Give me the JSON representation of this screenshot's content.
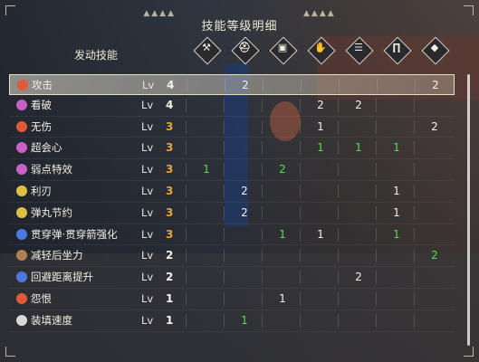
{
  "title": "技能等级明细",
  "header_label": "发动技能",
  "weapon_slots": [
    {
      "icon": "weapon-icon",
      "glyph": "⚒"
    },
    {
      "icon": "head-armor-icon",
      "glyph": "⛑"
    },
    {
      "icon": "chest-armor-icon",
      "glyph": "▣"
    },
    {
      "icon": "arm-armor-icon",
      "glyph": "✋"
    },
    {
      "icon": "waist-armor-icon",
      "glyph": "☰"
    },
    {
      "icon": "leg-armor-icon",
      "glyph": "∏"
    },
    {
      "icon": "talisman-icon",
      "glyph": "◆"
    }
  ],
  "level_prefix": "Lv",
  "skills": [
    {
      "name": "攻击",
      "icon_color": "#e05a3a",
      "level": "4",
      "level_color": "white",
      "selected": true,
      "cells": [
        {
          "v": "",
          "c": "white"
        },
        {
          "v": "2",
          "c": "white"
        },
        {
          "v": "",
          "c": "white"
        },
        {
          "v": "",
          "c": "white"
        },
        {
          "v": "",
          "c": "white"
        },
        {
          "v": "",
          "c": "white"
        },
        {
          "v": "2",
          "c": "white"
        }
      ]
    },
    {
      "name": "看破",
      "icon_color": "#c860c8",
      "level": "4",
      "level_color": "white",
      "selected": false,
      "cells": [
        {
          "v": "",
          "c": "white"
        },
        {
          "v": "",
          "c": "white"
        },
        {
          "v": "",
          "c": "white"
        },
        {
          "v": "2",
          "c": "white"
        },
        {
          "v": "2",
          "c": "white"
        },
        {
          "v": "",
          "c": "white"
        },
        {
          "v": "",
          "c": "white"
        }
      ]
    },
    {
      "name": "无伤",
      "icon_color": "#e05a3a",
      "level": "3",
      "level_color": "gold",
      "selected": false,
      "cells": [
        {
          "v": "",
          "c": "white"
        },
        {
          "v": "",
          "c": "white"
        },
        {
          "v": "",
          "c": "white"
        },
        {
          "v": "1",
          "c": "white"
        },
        {
          "v": "",
          "c": "white"
        },
        {
          "v": "",
          "c": "white"
        },
        {
          "v": "2",
          "c": "white"
        }
      ]
    },
    {
      "name": "超会心",
      "icon_color": "#c860c8",
      "level": "3",
      "level_color": "gold",
      "selected": false,
      "cells": [
        {
          "v": "",
          "c": "white"
        },
        {
          "v": "",
          "c": "white"
        },
        {
          "v": "",
          "c": "white"
        },
        {
          "v": "1",
          "c": "green"
        },
        {
          "v": "1",
          "c": "green"
        },
        {
          "v": "1",
          "c": "green"
        },
        {
          "v": "",
          "c": "white"
        }
      ]
    },
    {
      "name": "弱点特效",
      "icon_color": "#c860c8",
      "level": "3",
      "level_color": "gold",
      "selected": false,
      "cells": [
        {
          "v": "1",
          "c": "green"
        },
        {
          "v": "",
          "c": "white"
        },
        {
          "v": "2",
          "c": "green"
        },
        {
          "v": "",
          "c": "white"
        },
        {
          "v": "",
          "c": "white"
        },
        {
          "v": "",
          "c": "white"
        },
        {
          "v": "",
          "c": "white"
        }
      ]
    },
    {
      "name": "利刃",
      "icon_color": "#e0c040",
      "level": "3",
      "level_color": "gold",
      "selected": false,
      "cells": [
        {
          "v": "",
          "c": "white"
        },
        {
          "v": "2",
          "c": "white"
        },
        {
          "v": "",
          "c": "white"
        },
        {
          "v": "",
          "c": "white"
        },
        {
          "v": "",
          "c": "white"
        },
        {
          "v": "1",
          "c": "white"
        },
        {
          "v": "",
          "c": "white"
        }
      ]
    },
    {
      "name": "弹丸节约",
      "icon_color": "#e0c040",
      "level": "3",
      "level_color": "gold",
      "selected": false,
      "cells": [
        {
          "v": "",
          "c": "white"
        },
        {
          "v": "2",
          "c": "white"
        },
        {
          "v": "",
          "c": "white"
        },
        {
          "v": "",
          "c": "white"
        },
        {
          "v": "",
          "c": "white"
        },
        {
          "v": "1",
          "c": "white"
        },
        {
          "v": "",
          "c": "white"
        }
      ]
    },
    {
      "name": "贯穿弹·贯穿箭强化",
      "icon_color": "#4a7ae0",
      "level": "3",
      "level_color": "gold",
      "selected": false,
      "cells": [
        {
          "v": "",
          "c": "white"
        },
        {
          "v": "",
          "c": "white"
        },
        {
          "v": "1",
          "c": "green"
        },
        {
          "v": "1",
          "c": "white"
        },
        {
          "v": "",
          "c": "white"
        },
        {
          "v": "1",
          "c": "green"
        },
        {
          "v": "",
          "c": "white"
        }
      ]
    },
    {
      "name": "减轻后坐力",
      "icon_color": "#b08050",
      "level": "2",
      "level_color": "white",
      "selected": false,
      "cells": [
        {
          "v": "",
          "c": "white"
        },
        {
          "v": "",
          "c": "white"
        },
        {
          "v": "",
          "c": "white"
        },
        {
          "v": "",
          "c": "white"
        },
        {
          "v": "",
          "c": "white"
        },
        {
          "v": "",
          "c": "white"
        },
        {
          "v": "2",
          "c": "green"
        }
      ]
    },
    {
      "name": "回避距离提升",
      "icon_color": "#4a7ae0",
      "level": "2",
      "level_color": "white",
      "selected": false,
      "cells": [
        {
          "v": "",
          "c": "white"
        },
        {
          "v": "",
          "c": "white"
        },
        {
          "v": "",
          "c": "white"
        },
        {
          "v": "",
          "c": "white"
        },
        {
          "v": "2",
          "c": "white"
        },
        {
          "v": "",
          "c": "white"
        },
        {
          "v": "",
          "c": "white"
        }
      ]
    },
    {
      "name": "怨恨",
      "icon_color": "#e05a3a",
      "level": "1",
      "level_color": "white",
      "selected": false,
      "cells": [
        {
          "v": "",
          "c": "white"
        },
        {
          "v": "",
          "c": "white"
        },
        {
          "v": "1",
          "c": "white"
        },
        {
          "v": "",
          "c": "white"
        },
        {
          "v": "",
          "c": "white"
        },
        {
          "v": "",
          "c": "white"
        },
        {
          "v": "",
          "c": "white"
        }
      ]
    },
    {
      "name": "装填速度",
      "icon_color": "#d8d8d8",
      "level": "1",
      "level_color": "white",
      "selected": false,
      "cells": [
        {
          "v": "",
          "c": "white"
        },
        {
          "v": "1",
          "c": "green"
        },
        {
          "v": "",
          "c": "white"
        },
        {
          "v": "",
          "c": "white"
        },
        {
          "v": "",
          "c": "white"
        },
        {
          "v": "",
          "c": "white"
        },
        {
          "v": "",
          "c": "white"
        }
      ]
    }
  ]
}
